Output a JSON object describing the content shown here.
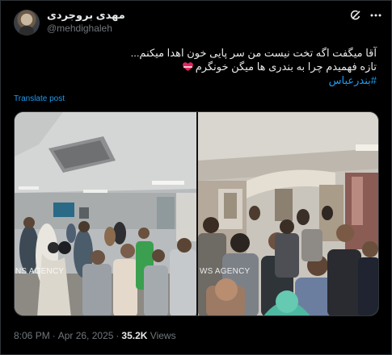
{
  "post": {
    "author_name": "مهدی بروجردی",
    "author_handle": "@mehdighaleh",
    "lines": [
      "آقا میگفت اگه تخت نیست من سر پایی خون اهدا میکنم...",
      "تازه فهمیدم چرا به بندری ها میگن خونگرم"
    ],
    "hashtag": "#بندرعباس",
    "translate_label": "Translate post",
    "time": "8:06 PM",
    "date": "Apr 26, 2025",
    "views_count": "35.2K",
    "views_label": "Views"
  },
  "media": {
    "watermark_left": "NS AGENCY",
    "watermark_right": "WS AGENCY"
  },
  "icons": {
    "grok": "grok-icon",
    "more": "more-icon",
    "heart": "heart-ribbon-icon"
  },
  "colors": {
    "background": "#000000",
    "text": "#e7e9ea",
    "secondary": "#71767b",
    "link": "#1d9bf0"
  }
}
